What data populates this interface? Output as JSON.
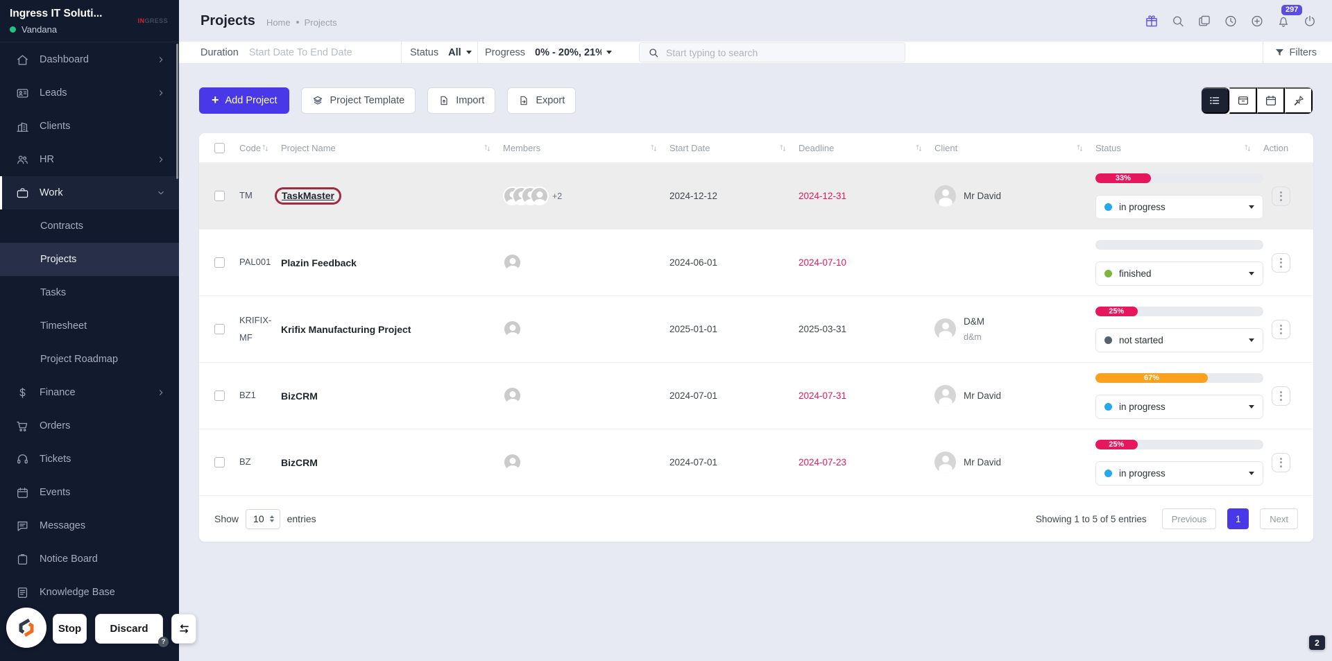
{
  "sidebar": {
    "company": "Ingress IT Soluti...",
    "user": "Vandana",
    "brand_red": "IN",
    "brand_dark": "GRESS",
    "items": [
      {
        "label": "Dashboard",
        "icon": "home",
        "chevron": "right"
      },
      {
        "label": "Leads",
        "icon": "leads",
        "chevron": "right"
      },
      {
        "label": "Clients",
        "icon": "clients"
      },
      {
        "label": "HR",
        "icon": "hr",
        "chevron": "right"
      },
      {
        "label": "Work",
        "icon": "work",
        "chevron": "down",
        "active": true
      },
      {
        "label": "Contracts",
        "sub": true
      },
      {
        "label": "Projects",
        "sub": true,
        "active": true
      },
      {
        "label": "Tasks",
        "sub": true
      },
      {
        "label": "Timesheet",
        "sub": true
      },
      {
        "label": "Project Roadmap",
        "sub": true
      },
      {
        "label": "Finance",
        "icon": "finance",
        "chevron": "right"
      },
      {
        "label": "Orders",
        "icon": "orders"
      },
      {
        "label": "Tickets",
        "icon": "tickets"
      },
      {
        "label": "Events",
        "icon": "events"
      },
      {
        "label": "Messages",
        "icon": "messages"
      },
      {
        "label": "Notice Board",
        "icon": "notice"
      },
      {
        "label": "Knowledge Base",
        "icon": "knowledge"
      }
    ]
  },
  "header": {
    "title": "Projects",
    "breadcrumb": [
      "Home",
      "Projects"
    ],
    "icons": [
      {
        "name": "gift-icon",
        "accent": true
      },
      {
        "name": "search-icon"
      },
      {
        "name": "pages-icon"
      },
      {
        "name": "clock-icon"
      },
      {
        "name": "plus-circle-icon"
      },
      {
        "name": "bell-icon",
        "badge": "297"
      },
      {
        "name": "power-icon"
      }
    ]
  },
  "filters": {
    "duration_label": "Duration",
    "duration_placeholder": "Start Date To End Date",
    "status_label": "Status",
    "status_value": "All",
    "progress_label": "Progress",
    "progress_value": "0% - 20%, 21%",
    "search_placeholder": "Start typing to search",
    "filters_label": "Filters"
  },
  "toolbar": {
    "add_project": "Add Project",
    "project_template": "Project Template",
    "import": "Import",
    "export": "Export"
  },
  "table": {
    "headers": [
      {
        "label": "Code",
        "sortable": true
      },
      {
        "label": "Project Name",
        "sortable": true
      },
      {
        "label": "Members",
        "sortable": true
      },
      {
        "label": "Start Date",
        "sortable": true
      },
      {
        "label": "Deadline",
        "sortable": true
      },
      {
        "label": "Client",
        "sortable": true
      },
      {
        "label": "Status",
        "sortable": true
      },
      {
        "label": "Action",
        "sortable": false
      }
    ],
    "rows": [
      {
        "code": "TM",
        "name": "TaskMaster",
        "annotated": true,
        "highlight": true,
        "members": 4,
        "members_extra": "+2",
        "start": "2024-12-12",
        "deadline": "2024-12-31",
        "deadline_overdue": true,
        "client": {
          "name": "Mr David"
        },
        "progress": {
          "pct": 33,
          "label": "33%",
          "color": "#e8175d"
        },
        "status": {
          "label": "in progress",
          "dot": "#24a8f0"
        }
      },
      {
        "code": "PAL001",
        "name": "Plazin Feedback",
        "members": 1,
        "start": "2024-06-01",
        "deadline": "2024-07-10",
        "deadline_overdue": true,
        "client": null,
        "progress": {
          "pct": 0,
          "label": "",
          "color": ""
        },
        "status": {
          "label": "finished",
          "dot": "#7cb63d"
        }
      },
      {
        "code": "KRIFIX-MF",
        "name": "Krifix Manufacturing Project",
        "members": 1,
        "start": "2025-01-01",
        "deadline": "2025-03-31",
        "deadline_overdue": false,
        "client": {
          "name": "D&M",
          "sub": "d&m"
        },
        "progress": {
          "pct": 25,
          "label": "25%",
          "color": "#e8175d"
        },
        "status": {
          "label": "not started",
          "dot": "#566270"
        }
      },
      {
        "code": "BZ1",
        "name": "BizCRM",
        "members": 1,
        "start": "2024-07-01",
        "deadline": "2024-07-31",
        "deadline_overdue": true,
        "client": {
          "name": "Mr David"
        },
        "progress": {
          "pct": 67,
          "label": "67%",
          "color": "#faa21b"
        },
        "status": {
          "label": "in progress",
          "dot": "#24a8f0"
        }
      },
      {
        "code": "BZ",
        "name": "BizCRM",
        "members": 1,
        "start": "2024-07-01",
        "deadline": "2024-07-23",
        "deadline_overdue": true,
        "client": {
          "name": "Mr David"
        },
        "progress": {
          "pct": 25,
          "label": "25%",
          "color": "#e8175d"
        },
        "status": {
          "label": "in progress",
          "dot": "#24a8f0"
        }
      }
    ]
  },
  "pagination": {
    "show_label": "Show",
    "per_page": "10",
    "entries_label": "entries",
    "summary": "Showing 1 to 5 of 5 entries",
    "previous": "Previous",
    "page": "1",
    "next": "Next"
  },
  "overlay": {
    "stop": "Stop",
    "discard": "Discard",
    "help": "?",
    "count_badge": "2"
  }
}
